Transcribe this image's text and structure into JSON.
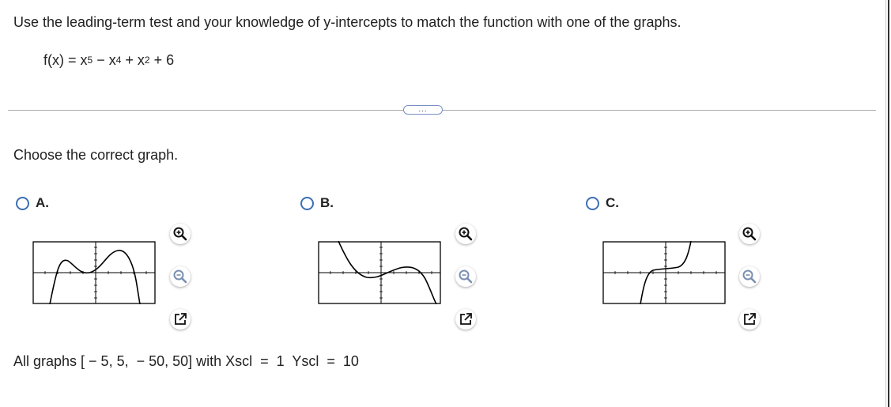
{
  "question": {
    "instruction": "Use the leading-term test and your knowledge of y-intercepts to match the function with one of the graphs.",
    "formula_prefix": "f(x) = x",
    "exp1": "5",
    "mid1": " − x",
    "exp2": "4",
    "mid2": " + x",
    "exp3": "2",
    "tail": " + 6"
  },
  "more_button": "...",
  "prompt": "Choose the correct graph.",
  "options": [
    {
      "label": "A."
    },
    {
      "label": "B."
    },
    {
      "label": "C."
    }
  ],
  "footer": "All graphs [ − 5, 5,  − 50, 50] with Xscl  =  1  Yscl  =  10",
  "icons": {
    "zoom_in": "zoom-in-icon",
    "zoom_out": "zoom-out-icon",
    "open_new": "open-new-window-icon"
  },
  "colors": {
    "radio": "#3b6fb5",
    "zoom_in": "#111111",
    "zoom_out": "#7a8fb0"
  }
}
